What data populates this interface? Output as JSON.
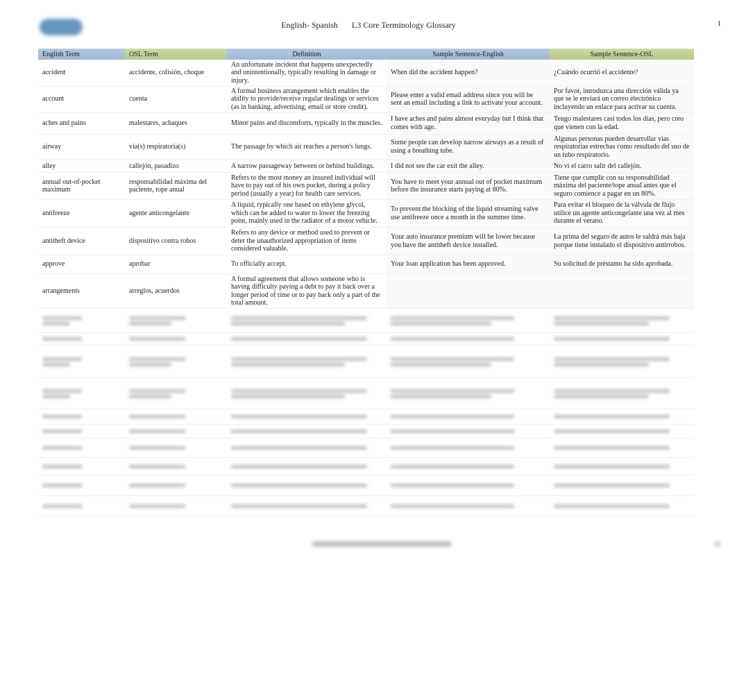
{
  "header": {
    "title_left": "English- Spanish",
    "title_right": "L3 Core Terminology Glossary",
    "page_number": "1"
  },
  "table": {
    "columns": [
      "English Term",
      "OSL Term",
      "Definition",
      "Sample Sentence-English",
      "Sample Sentence-OSL"
    ],
    "rows": [
      [
        "accident",
        "accidente, colisión, choque",
        "An unfortunate incident that happens unexpectedly and unintentionally, typically resulting in damage or injury.",
        "When did the accident happen?",
        "¿Cuándo ocurrió el accidente?"
      ],
      [
        "account",
        "cuenta",
        "A formal business arrangement which enables the ability to provide/receive regular dealings or services (as in banking, advertising, email or store credit).",
        "Please enter a valid email address since you will be sent an email including a link to activate your account.",
        "Por favor, introduzca una dirección válida ya que se le enviará un correo electrónico incluyendo un enlace para activar su cuenta."
      ],
      [
        "aches and pains",
        "malestares, achaques",
        "Minor pains and discomforts, typically in the muscles.",
        "I have aches and pains almost everyday but I think that comes with age.",
        "Tengo malestares casi todos los dias, pero creo que vienen con la edad."
      ],
      [
        "airway",
        "via(s)   respiratoria(s)",
        "The passage by which air reaches a person's lungs.",
        "Some people can develop narrow airways as a result of using a breathing tube.",
        "Algunas personas pueden desarrollar vias respiratorias estrechas como resultado del uso de un tubo respiratorio."
      ],
      [
        "alley",
        "callejón, pasadizo",
        "A narrow passageway between or behind buildings.",
        "I did not see the car exit the alley.",
        "No vi el carro salir del callejón."
      ],
      [
        "annual out-of-pocket maximum",
        "responsabilidad máxima del paciente, tope anual",
        "Refers to the most money an insured individual will have to pay out of his own pocket, during a policy period (usually a year) for health care services.",
        "You have to meet your annual out of pocket maximum before the insurance starts paying at 80%.",
        "Tiene que cumplir con su responsabilidad máxima del paciente/tope anual antes que el seguro comience a pagar en un 80%."
      ],
      [
        "antifreeze",
        "agente anticongelante",
        "A liquid, typically one based on ethylene glycol, which can be added to water to lower the freezing point, mainly   used in the radiator of a motor vehicle.",
        "To prevent the blocking of the liquid streaming valve use antifreeze once a month in the summer time.",
        "Para evitar el bloqueo de la válvula de flujo utilice un agente anticongelante una vez al mes durante el verano."
      ],
      [
        "antitheft device",
        "dispositivo contra robos",
        "Refers to any device or method used to prevent or deter the unauthorized appropriation of items considered valuable.",
        "Your auto insurance premium will be lower because you have the antitheft device installed.",
        "La prima del seguro de autos le saldrá más baja porque tiene instalado el dispositivo antirrobos."
      ],
      [
        "approve",
        "aprobar",
        "To officially accept.",
        "Your loan application has been approved.",
        "Su solicitud de préstamo ha sido aprobada."
      ],
      [
        "arrangements",
        "arreglos, acuerdos",
        "A formal agreement that allows someone who is having difficulty paying a debt to pay it back over a longer period of time or to pay back only a part of the total amount.",
        "",
        ""
      ]
    ]
  },
  "colors": {
    "header_blue": "#a8bfdb",
    "header_green": "#bfd196",
    "logo": "#4a86b3"
  }
}
